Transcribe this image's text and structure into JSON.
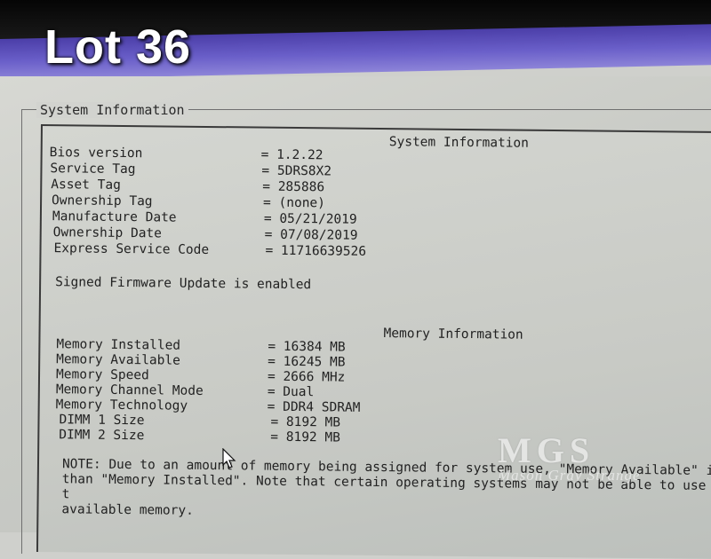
{
  "overlay": {
    "lot_label": "Lot 36"
  },
  "group": {
    "legend": "System Information"
  },
  "system_info": {
    "title": "System Information",
    "rows": [
      {
        "label": "Bios version",
        "value": "= 1.2.22"
      },
      {
        "label": "Service Tag",
        "value": "= 5DRS8X2"
      },
      {
        "label": "Asset Tag",
        "value": "= 285886"
      },
      {
        "label": "Ownership Tag",
        "value": "= (none)"
      },
      {
        "label": "Manufacture Date",
        "value": "= 05/21/2019"
      },
      {
        "label": "Ownership Date",
        "value": "= 07/08/2019"
      },
      {
        "label": "Express Service Code",
        "value": "= 11716639526"
      }
    ],
    "firmware_note": "Signed Firmware Update is enabled"
  },
  "memory_info": {
    "title": "Memory Information",
    "rows": [
      {
        "label": "Memory Installed",
        "value": "= 16384 MB"
      },
      {
        "label": "Memory Available",
        "value": "= 16245 MB"
      },
      {
        "label": "Memory Speed",
        "value": "= 2666 MHz"
      },
      {
        "label": "Memory Channel Mode",
        "value": "= Dual"
      },
      {
        "label": "Memory Technology",
        "value": "= DDR4 SDRAM"
      },
      {
        "label": "DIMM 1 Size",
        "value": "= 8192 MB"
      },
      {
        "label": "DIMM 2 Size",
        "value": "= 8192 MB"
      }
    ],
    "note_lines": [
      "NOTE: Due to an amount of memory being assigned for system use, \"Memory Available\" is",
      "than \"Memory Installed\". Note that certain operating systems may not be able to use all t",
      "available memory."
    ]
  },
  "watermark": {
    "logo": "MGS",
    "text": "Mason Gray Strange"
  },
  "colors": {
    "title_band": "#5a4fbf",
    "screen_bg": "#cfd0cc",
    "text": "#222222"
  },
  "icons": {
    "cursor": "arrow-pointer"
  }
}
